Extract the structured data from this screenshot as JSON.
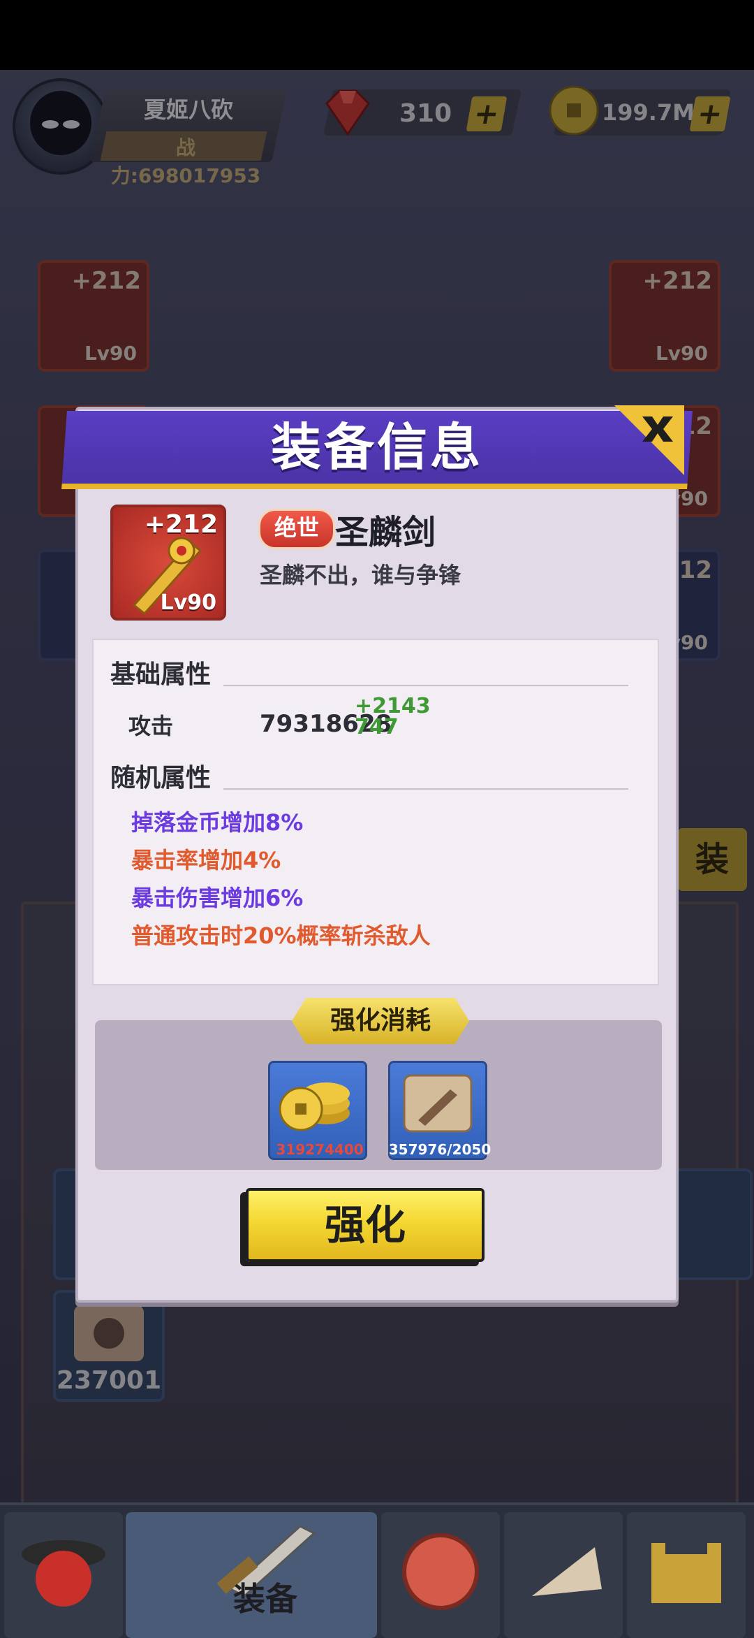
{
  "player": {
    "name": "夏姬八砍",
    "power": "战力:698017953"
  },
  "resources": {
    "gems": "310",
    "coins": "199.7M"
  },
  "side_slots": {
    "left_top": {
      "plus": "+212",
      "level": "Lv90"
    },
    "right_top": {
      "plus": "+212",
      "level": "Lv90"
    },
    "right_mid": {
      "plus": "+212",
      "level": "Lv90"
    },
    "right_low": {
      "plus": "+212",
      "level": "Lv90"
    }
  },
  "side_button": {
    "label": "装"
  },
  "inventory": {
    "scroll_count": "237001"
  },
  "bottom_nav": {
    "active_label": "装备"
  },
  "modal": {
    "title": "装备信息",
    "item": {
      "plus": "+212",
      "level": "Lv90",
      "rarity": "绝世",
      "name": "圣麟剑",
      "description": "圣麟不出，谁与争锋"
    },
    "base_section_title": "基础属性",
    "base_stat": {
      "label": "攻击",
      "value": "79318628",
      "bonus": "+2143747"
    },
    "random_section_title": "随机属性",
    "random_stats": [
      {
        "text": "掉落金币增加8%",
        "color": "#6b3be0"
      },
      {
        "text": "暴击率增加4%",
        "color": "#e05a2e"
      },
      {
        "text": "暴击伤害增加6%",
        "color": "#6b3be0"
      },
      {
        "text": "普通攻击时20%概率斩杀敌人",
        "color": "#e05a2e"
      }
    ],
    "cost_title": "强化消耗",
    "costs": [
      {
        "icon": "coin-stack-icon",
        "amount": "319274400",
        "color": "#e84a3a"
      },
      {
        "icon": "scroll-icon",
        "amount": "357976/2050",
        "color": "#ffffff"
      }
    ],
    "enhance_button": "强化"
  }
}
